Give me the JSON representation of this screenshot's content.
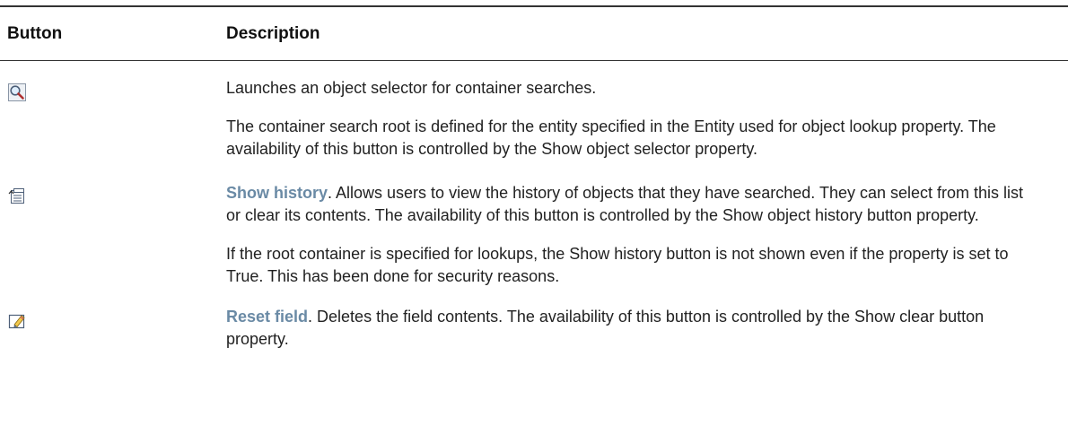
{
  "table": {
    "headers": {
      "button": "Button",
      "description": "Description"
    },
    "rows": [
      {
        "icon": "magnifier-icon",
        "paragraphs": [
          "Launches an object selector for container searches.",
          "The container search root is defined for the entity specified in the Entity used for object lookup property. The availability of this button is controlled by the Show object selector property."
        ]
      },
      {
        "icon": "history-icon",
        "link": "Show history",
        "paragraph1_rest": ". Allows users to view the history of objects that they have searched. They can select from this list or clear its contents. The availability of this button is controlled by the Show object history button property.",
        "paragraph2": "If the root container is specified for lookups, the Show history button is not shown even if the property is set to True. This has been done for security reasons."
      },
      {
        "icon": "reset-field-icon",
        "link": "Reset field",
        "paragraph1_rest": ". Deletes the field contents. The availability of this button is controlled by the Show clear button property."
      }
    ]
  }
}
